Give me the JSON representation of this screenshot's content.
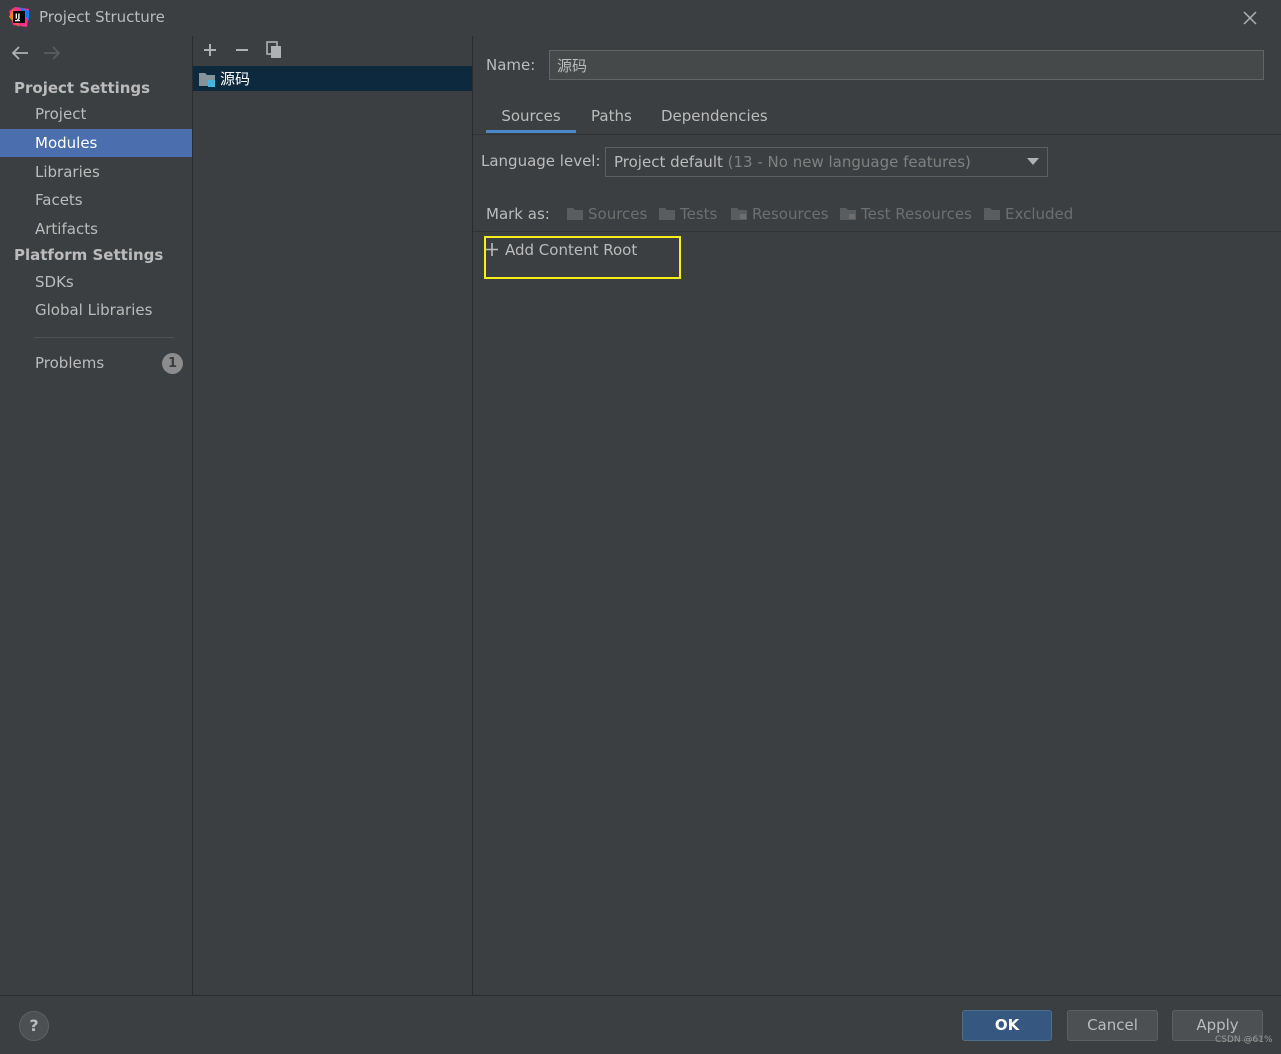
{
  "window": {
    "title": "Project Structure"
  },
  "sidebar": {
    "project_settings_title": "Project Settings",
    "project_items": [
      "Project",
      "Modules",
      "Libraries",
      "Facets",
      "Artifacts"
    ],
    "selected_item": "Modules",
    "platform_settings_title": "Platform Settings",
    "platform_items": [
      "SDKs",
      "Global Libraries"
    ],
    "problems_label": "Problems",
    "problems_count": "1"
  },
  "modules": {
    "items": [
      "源码"
    ],
    "selected": "源码"
  },
  "detail": {
    "name_label": "Name:",
    "name_value": "源码",
    "tabs": [
      "Sources",
      "Paths",
      "Dependencies"
    ],
    "active_tab": "Sources",
    "language_level_label": "Language level:",
    "language_level_value": "Project default",
    "language_level_detail": "(13 - No new language features)",
    "mark_as_label": "Mark as:",
    "mark_as_options": [
      "Sources",
      "Tests",
      "Resources",
      "Test Resources",
      "Excluded"
    ],
    "add_content_root_label": "Add Content Root"
  },
  "footer": {
    "help_label": "?",
    "ok_label": "OK",
    "cancel_label": "Cancel",
    "apply_label": "Apply",
    "watermark": "CSDN @61%"
  },
  "colors": {
    "background": "#3c3f41",
    "selection": "#4b6eaf",
    "module_selection": "#0d293e",
    "highlight_box": "#f5ee1b",
    "ok_button": "#365880",
    "tab_underline": "#4a88c7"
  }
}
